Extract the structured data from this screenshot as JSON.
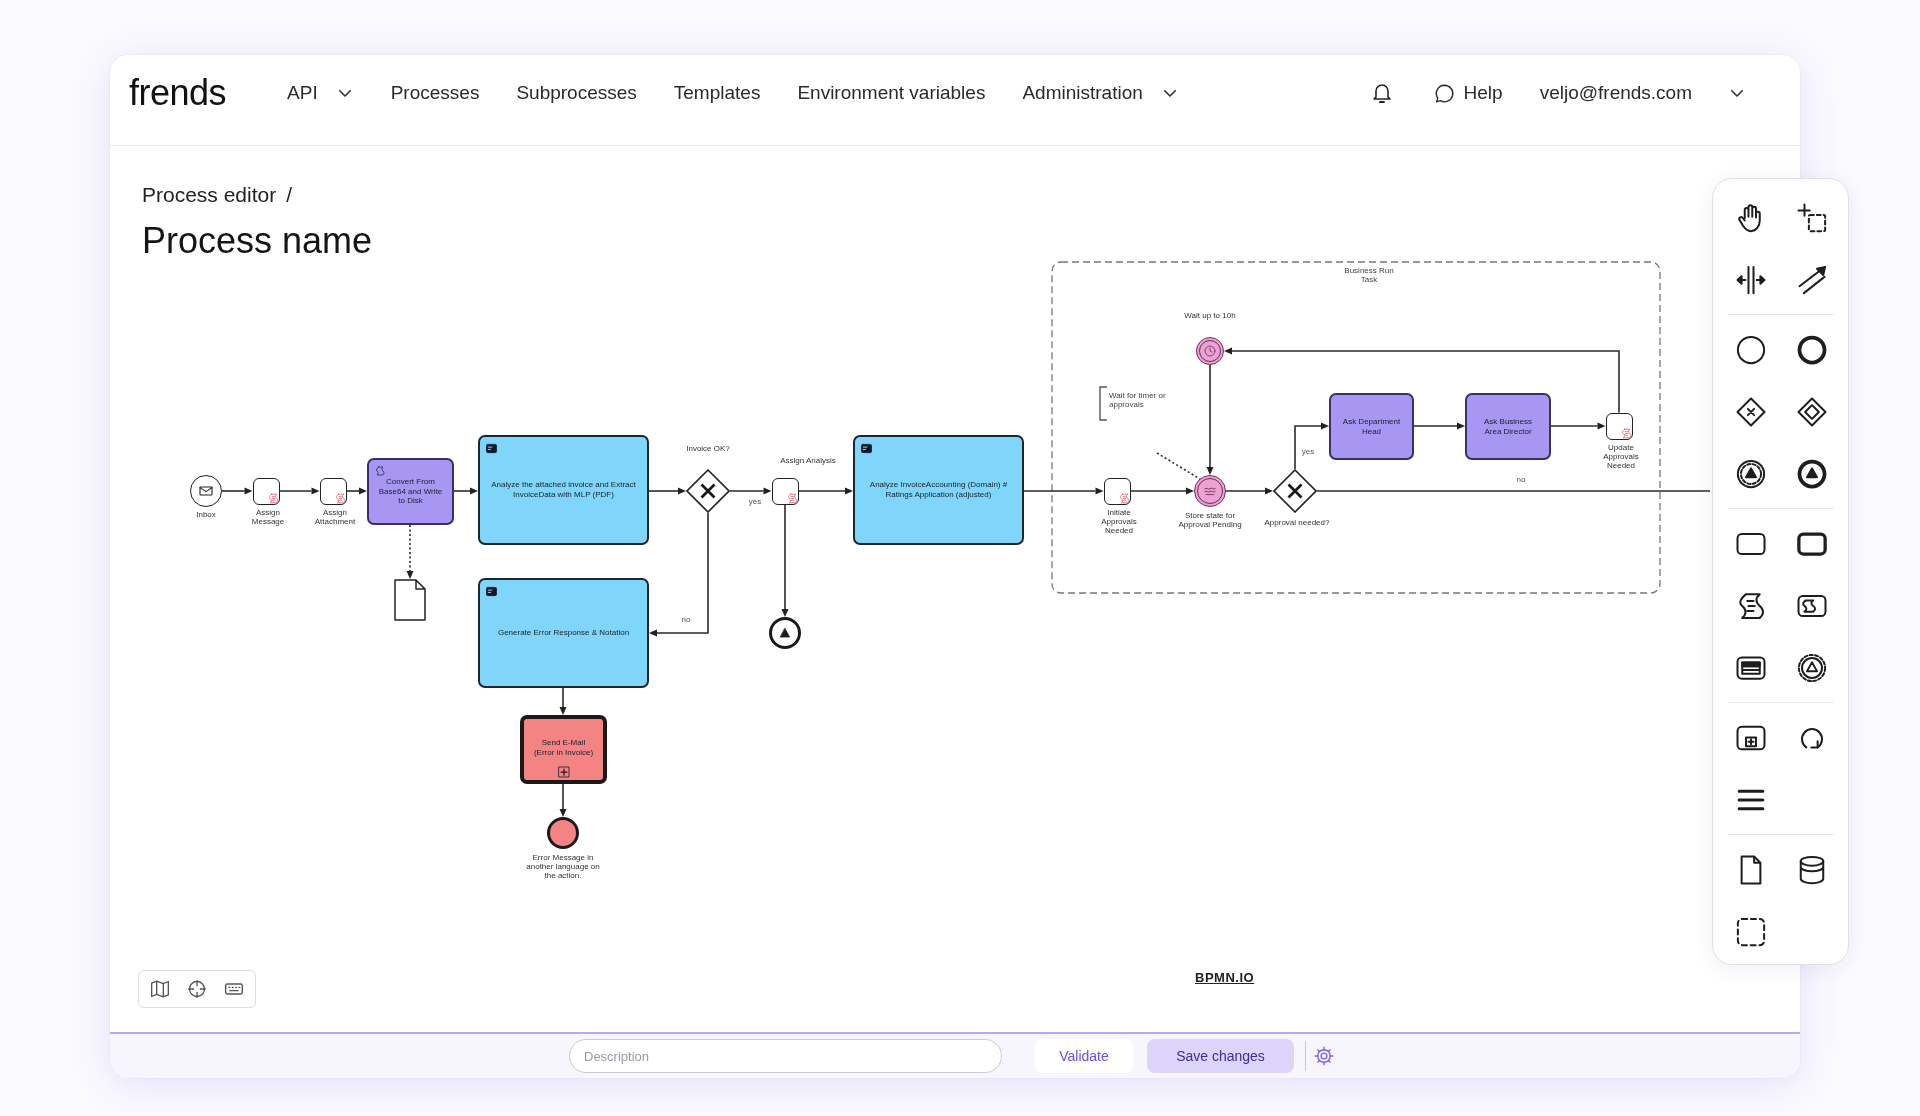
{
  "header": {
    "logo": "frends",
    "nav": [
      {
        "label": "API",
        "dropdown": true
      },
      {
        "label": "Processes",
        "dropdown": false
      },
      {
        "label": "Subprocesses",
        "dropdown": false
      },
      {
        "label": "Templates",
        "dropdown": false
      },
      {
        "label": "Environment variables",
        "dropdown": false
      },
      {
        "label": "Administration",
        "dropdown": true
      }
    ],
    "help": "Help",
    "user": "veljo@frends.com"
  },
  "breadcrumb": {
    "items": [
      "Process editor"
    ],
    "separator": "/"
  },
  "title": "Process name",
  "diagram": {
    "nodes": [
      {
        "kind": "start_event",
        "label": "Inbox"
      },
      {
        "kind": "script_task",
        "label": "Assign Message"
      },
      {
        "kind": "script_task",
        "label": "Assign Attachment"
      },
      {
        "kind": "service_task",
        "label": "Convert From Base64 and Write to Disk",
        "color": "#a797f2"
      },
      {
        "kind": "data_object"
      },
      {
        "kind": "connector_task",
        "label": "Analyze the attached invoice and Extract InvoiceData with MLP (PDF)",
        "color": "#7fd6fa"
      },
      {
        "kind": "connector_task",
        "label": "Generate Error Response & Notation",
        "color": "#7fd6fa"
      },
      {
        "kind": "subprocess",
        "label": "Send E-Mail (Error in Invoice)",
        "color": "#f48383"
      },
      {
        "kind": "end_event",
        "label": "Error Message in another language on the action.",
        "color": "#f48383"
      },
      {
        "kind": "gateway",
        "label": "Invoice OK?"
      },
      {
        "kind": "script_task",
        "label": "Assign Analysis"
      },
      {
        "kind": "escalation_end_event"
      },
      {
        "kind": "connector_task",
        "label": "Analyze InvoiceAccounting (Domain) # Ratings Application (adjusted)",
        "color": "#7fd6fa"
      },
      {
        "kind": "script_task",
        "label": "Initiate Approvals Needed"
      },
      {
        "kind": "timer_event",
        "label": "Wait up to 10h",
        "color": "#eaa3d2"
      },
      {
        "kind": "intermediate_event",
        "label": "Store state for Approval Pending",
        "color": "#eaa3d2"
      },
      {
        "kind": "gateway",
        "label": "Approval needed?"
      },
      {
        "kind": "task",
        "label": "Ask Department Head",
        "color": "#a797f2"
      },
      {
        "kind": "task",
        "label": "Ask Business Area Director",
        "color": "#a797f2"
      },
      {
        "kind": "script_task",
        "label": "Update Approvals Needed"
      }
    ],
    "flow_labels": [
      "yes",
      "no",
      "yes",
      "no"
    ],
    "group": {
      "label": "Business Run Task"
    },
    "annotation": "Wait for timer or approvals",
    "branding_link": "BPMN.IO"
  },
  "footer": {
    "description": {
      "placeholder": "Description"
    },
    "buttons": [
      {
        "label": "Validate",
        "kind": "secondary"
      },
      {
        "label": "Save changes",
        "kind": "primary"
      }
    ]
  }
}
